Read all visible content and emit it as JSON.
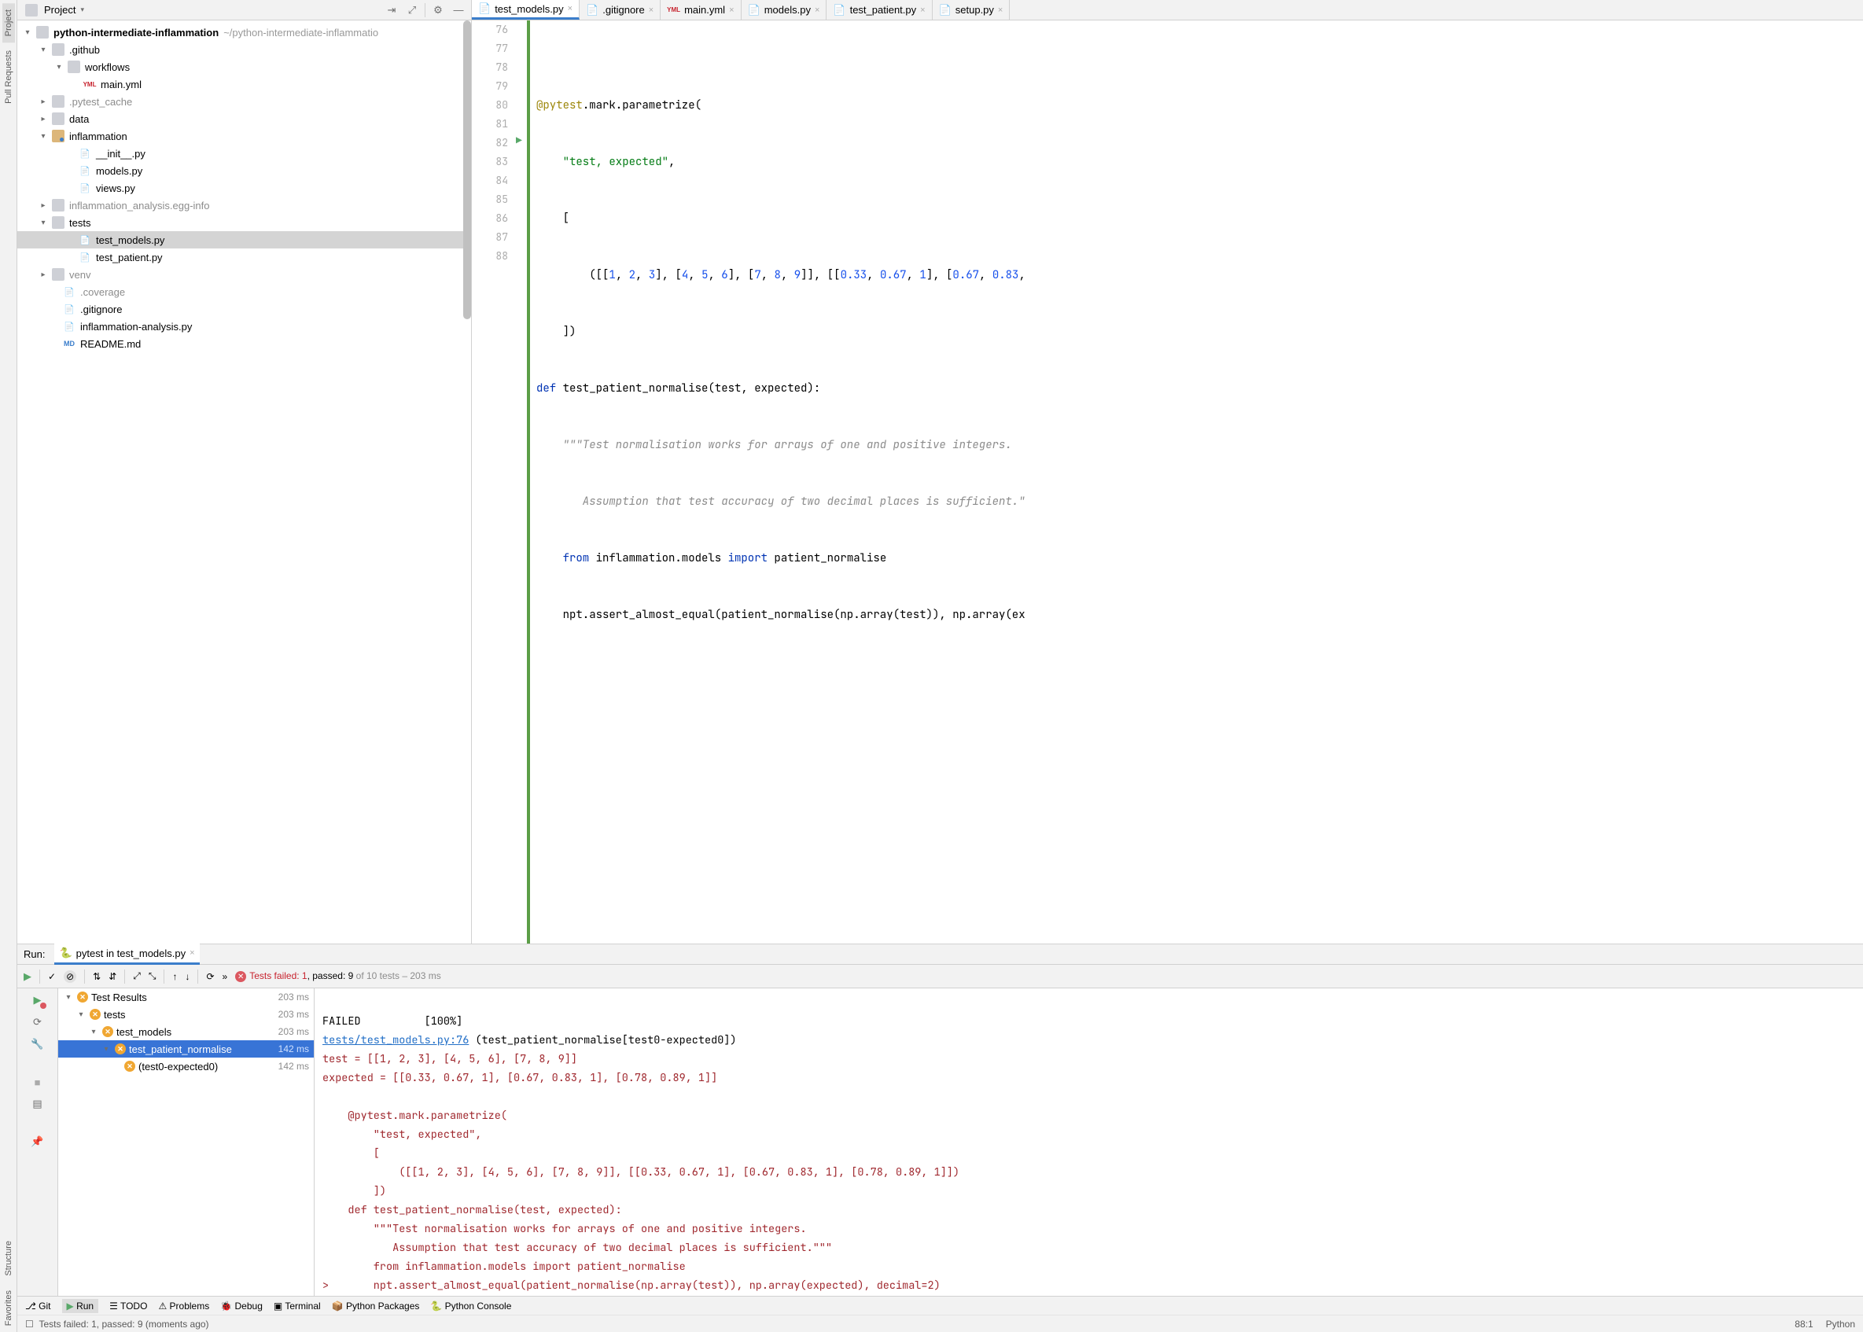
{
  "left_gutter": {
    "project": "Project",
    "pull_requests": "Pull Requests",
    "structure": "Structure",
    "favorites": "Favorites"
  },
  "project_panel": {
    "title": "Project",
    "root": "python-intermediate-inflammation",
    "root_path": "~/python-intermediate-inflammatio",
    "items": {
      "github": ".github",
      "workflows": "workflows",
      "main_yml": "main.yml",
      "pytest_cache": ".pytest_cache",
      "data": "data",
      "inflammation": "inflammation",
      "init_py": "__init__.py",
      "models_py": "models.py",
      "views_py": "views.py",
      "egg_info": "inflammation_analysis.egg-info",
      "tests": "tests",
      "test_models": "test_models.py",
      "test_patient": "test_patient.py",
      "venv": "venv",
      "coverage": ".coverage",
      "gitignore": ".gitignore",
      "analysis_py": "inflammation-analysis.py",
      "readme": "README.md"
    }
  },
  "editor_tabs": {
    "t0": "test_models.py",
    "t1": ".gitignore",
    "t2": "main.yml",
    "t3": "models.py",
    "t4": "test_patient.py",
    "t5": "setup.py"
  },
  "code": {
    "lines": [
      "76",
      "77",
      "78",
      "79",
      "80",
      "81",
      "82",
      "83",
      "84",
      "85",
      "86",
      "87",
      "88"
    ],
    "l77a": "@pytest",
    "l77b": ".mark.parametrize(",
    "l78": "\"test, expected\"",
    "l78b": ",",
    "l79": "[",
    "l80a": "([[",
    "l80b": "1",
    "l80c": ", ",
    "l80d": "2",
    "l80e": ", ",
    "l80f": "3",
    "l80g": "], [",
    "l80h": "4",
    "l80i": ", ",
    "l80j": "5",
    "l80k": ", ",
    "l80l": "6",
    "l80m": "], [",
    "l80n": "7",
    "l80o": ", ",
    "l80p": "8",
    "l80q": ", ",
    "l80r": "9",
    "l80s": "]], [[",
    "l80t": "0.33",
    "l80u": ", ",
    "l80v": "0.67",
    "l80w": ", ",
    "l80x": "1",
    "l80y": "], [",
    "l80z": "0.67",
    "l80aa": ", ",
    "l80ab": "0.83",
    "l80ac": ",",
    "l81": "])",
    "l82a": "def ",
    "l82b": "test_patient_normalise(test, expected):",
    "l83": "\"\"\"Test normalisation works for arrays of one and positive integers.",
    "l84": "   Assumption that test accuracy of two decimal places is sufficient.\"",
    "l85a": "from ",
    "l85b": "inflammation.models ",
    "l85c": "import ",
    "l85d": "patient_normalise",
    "l86": "npt.assert_almost_equal(patient_normalise(np.array(test)), np.array(ex"
  },
  "run": {
    "label": "Run:",
    "tab": "pytest in test_models.py",
    "summary_fail": "Tests failed: 1",
    "summary_pass": ", passed: 9",
    "summary_rest": " of 10 tests – 203 ms"
  },
  "test_tree": {
    "root": "Test Results",
    "root_t": "203 ms",
    "tests": "tests",
    "tests_t": "203 ms",
    "models": "test_models",
    "models_t": "203 ms",
    "normalise": "test_patient_normalise",
    "normalise_t": "142 ms",
    "case": "(test0-expected0)",
    "case_t": "142 ms"
  },
  "console": {
    "l1a": "FAILED",
    "l1b": "          [100%]",
    "l2a": "tests/test_models.py:76",
    "l2b": " (test_patient_normalise[test0-expected0])",
    "l3": "test = [[1, 2, 3], [4, 5, 6], [7, 8, 9]]",
    "l4": "expected = [[0.33, 0.67, 1], [0.67, 0.83, 1], [0.78, 0.89, 1]]",
    "l5": "",
    "l6": "    @pytest.mark.parametrize(",
    "l7": "        \"test, expected\",",
    "l8": "        [",
    "l9": "            ([[1, 2, 3], [4, 5, 6], [7, 8, 9]], [[0.33, 0.67, 1], [0.67, 0.83, 1], [0.78, 0.89, 1]])",
    "l10": "        ])",
    "l11": "    def test_patient_normalise(test, expected):",
    "l12": "        \"\"\"Test normalisation works for arrays of one and positive integers.",
    "l13": "           Assumption that test accuracy of two decimal places is sufficient.\"\"\"",
    "l14": "        from inflammation.models import patient_normalise",
    "l15": ">       npt.assert_almost_equal(patient_normalise(np.array(test)), np.array(expected), decimal=2)"
  },
  "bottom_bar": {
    "git": "Git",
    "run": "Run",
    "todo": "TODO",
    "problems": "Problems",
    "debug": "Debug",
    "terminal": "Terminal",
    "packages": "Python Packages",
    "console": "Python Console"
  },
  "status_bar": {
    "msg": "Tests failed: 1, passed: 9 (moments ago)",
    "pos": "88:1",
    "lang": "Python"
  }
}
